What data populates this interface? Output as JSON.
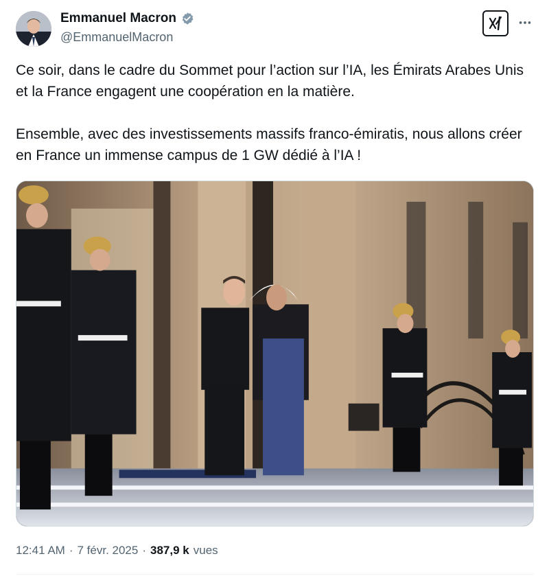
{
  "author": {
    "display_name": "Emmanuel Macron",
    "handle": "@EmmanuelMacron",
    "verified_icon": "verified-badge-icon",
    "verified_color": "#829aab"
  },
  "actions": {
    "grok_icon": "grok-icon",
    "more_icon": "more-dots-icon"
  },
  "tweet": {
    "paragraph_1": "Ce soir, dans le cadre du Sommet pour l’action sur l’IA, les Émirats Arabes Unis et la France engagent une coopération en la matière.",
    "paragraph_2": "Ensemble, avec des investissements massifs franco-émiratis, nous allons créer en France un immense campus de 1 GW dédié à l’IA !"
  },
  "meta": {
    "time": "12:41 AM",
    "separator": "·",
    "date": "7 févr. 2025",
    "views_count": "387,9 k",
    "views_label": "vues"
  },
  "colors": {
    "text_primary": "#0f1419",
    "text_secondary": "#536471",
    "border": "#cfd9de"
  }
}
